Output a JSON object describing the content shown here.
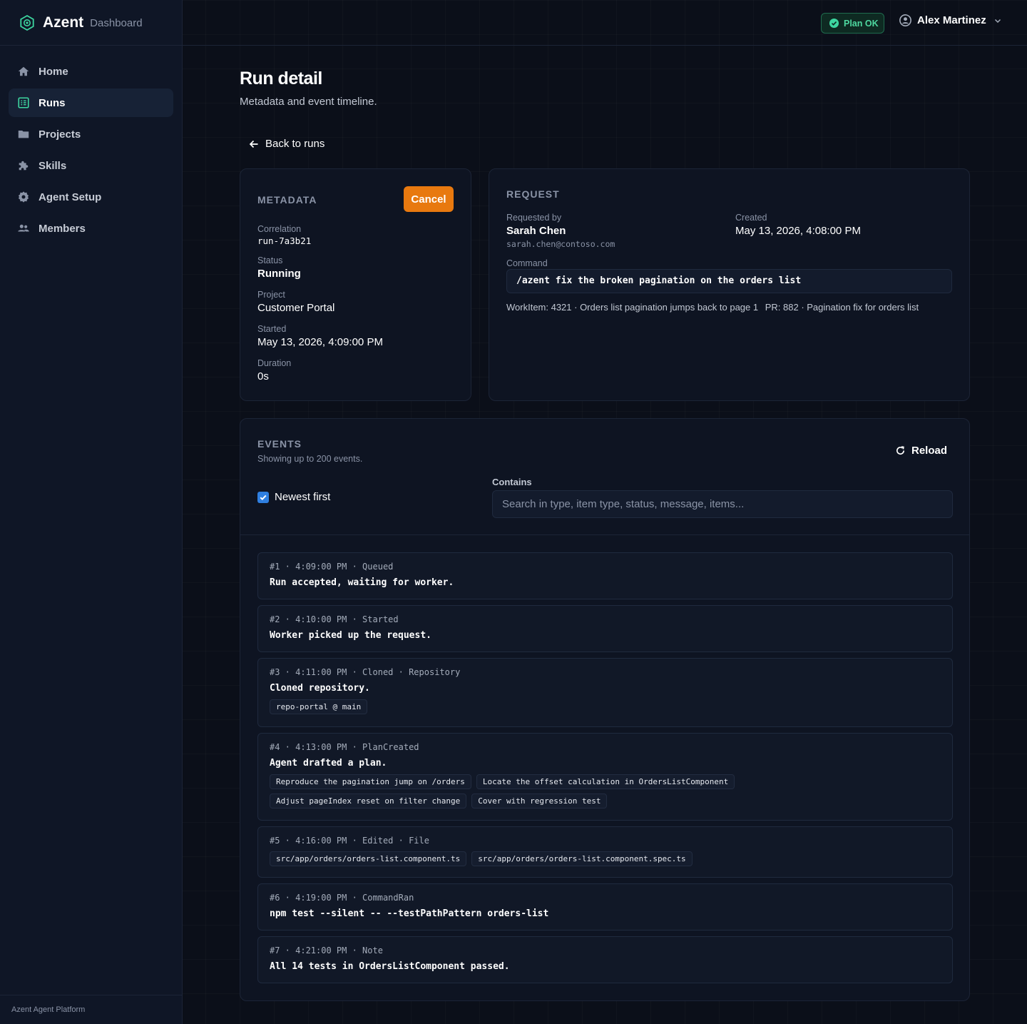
{
  "brand": {
    "name": "Azent",
    "sub": "Dashboard",
    "accent": "#3dd6a0"
  },
  "nav": [
    {
      "label": "Home",
      "icon": "home-icon"
    },
    {
      "label": "Runs",
      "icon": "list-icon",
      "active": true
    },
    {
      "label": "Projects",
      "icon": "folder-icon"
    },
    {
      "label": "Skills",
      "icon": "puzzle-icon"
    },
    {
      "label": "Agent Setup",
      "icon": "gear-icon"
    },
    {
      "label": "Members",
      "icon": "users-icon"
    }
  ],
  "footer": "Azent Agent Platform",
  "topbar": {
    "plan_badge": "Plan OK",
    "user_name": "Alex Martinez"
  },
  "page": {
    "title": "Run detail",
    "subtitle": "Metadata and event timeline.",
    "back": "Back to runs"
  },
  "metadata": {
    "label": "METADATA",
    "cancel": "Cancel",
    "fields": {
      "correlation": {
        "label": "Correlation",
        "value": "run-7a3b21"
      },
      "status": {
        "label": "Status",
        "value": "Running"
      },
      "project": {
        "label": "Project",
        "value": "Customer Portal"
      },
      "started": {
        "label": "Started",
        "value": "May 13, 2026, 4:09:00 PM"
      },
      "duration": {
        "label": "Duration",
        "value": "0s"
      }
    }
  },
  "request": {
    "label": "REQUEST",
    "requested_by_label": "Requested by",
    "requested_by": "Sarah Chen",
    "email": "sarah.chen@contoso.com",
    "created_label": "Created",
    "created": "May 13, 2026, 4:08:00 PM",
    "command_label": "Command",
    "command": "/azent fix the broken pagination on the orders list",
    "workitem": "WorkItem: 4321 · Orders list pagination jumps back to page 1",
    "pr": "PR: 882 · Pagination fix for orders list"
  },
  "events": {
    "label": "EVENTS",
    "sub": "Showing up to 200 events.",
    "reload": "Reload",
    "newest_first": "Newest first",
    "search_label": "Contains",
    "search_placeholder": "Search in type, item type, status, message, items...",
    "items": [
      {
        "head": "#1 · 4:09:00 PM · Queued",
        "msg": "Run accepted, waiting for worker."
      },
      {
        "head": "#2 · 4:10:00 PM · Started",
        "msg": "Worker picked up the request."
      },
      {
        "head": "#3 · 4:11:00 PM · Cloned · Repository",
        "msg": "Cloned repository.",
        "chips": [
          "repo-portal @ main"
        ]
      },
      {
        "head": "#4 · 4:13:00 PM · PlanCreated",
        "msg": "Agent drafted a plan.",
        "chips": [
          "Reproduce the pagination jump on /orders",
          "Locate the offset calculation in OrdersListComponent",
          "Adjust pageIndex reset on filter change",
          "Cover with regression test"
        ]
      },
      {
        "head": "#5 · 4:16:00 PM · Edited · File",
        "chips": [
          "src/app/orders/orders-list.component.ts",
          "src/app/orders/orders-list.component.spec.ts"
        ]
      },
      {
        "head": "#6 · 4:19:00 PM · CommandRan",
        "msg": "npm test --silent -- --testPathPattern orders-list"
      },
      {
        "head": "#7 · 4:21:00 PM · Note",
        "msg": "All 14 tests in OrdersListComponent passed."
      }
    ]
  }
}
